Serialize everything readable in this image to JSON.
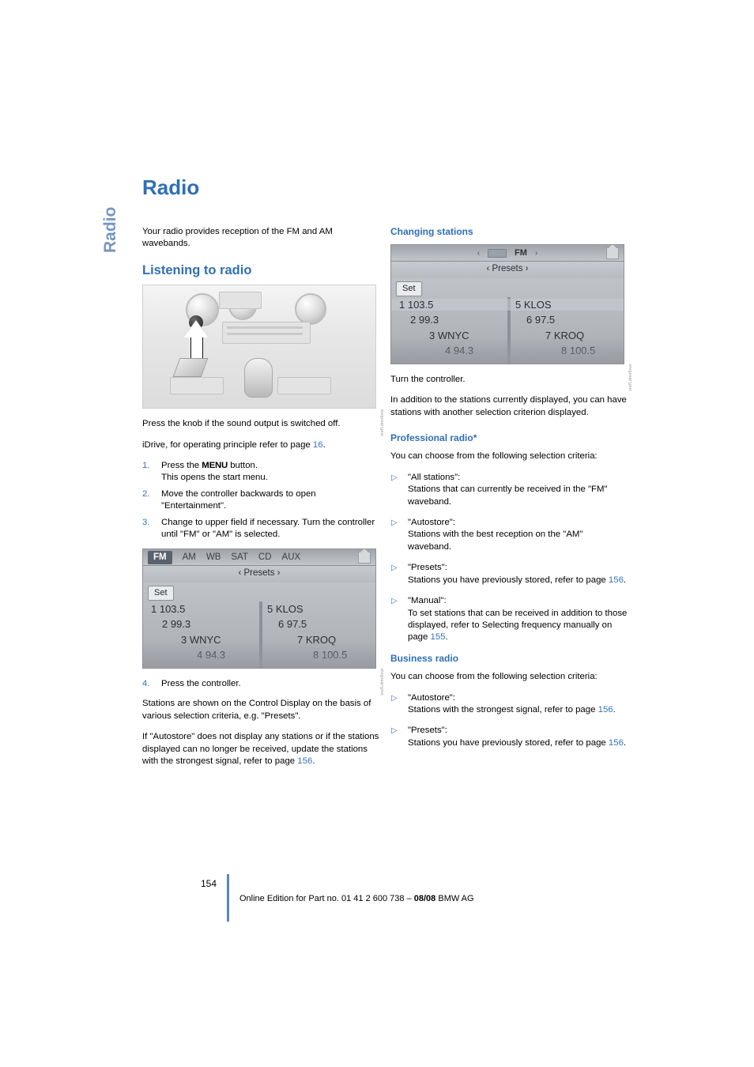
{
  "chapter_tab": "Radio",
  "page_title": "Radio",
  "left_column": {
    "intro": "Your radio provides reception of the FM and AM wavebands.",
    "section_heading": "Listening to radio",
    "figure_dashboard_credit": "vnd'Ldmn6vvv",
    "after_image_1": "Press the knob if the sound output is switched off.",
    "after_image_2_pre": "iDrive, for operating principle refer to page ",
    "after_image_2_ref": "16",
    "after_image_2_post": ".",
    "steps": [
      {
        "num": "1.",
        "text_pre": "Press the ",
        "bold": "MENU",
        "text_post": " button.",
        "line2": "This opens the start menu."
      },
      {
        "num": "2.",
        "text": "Move the controller backwards to open \"Entertainment\"."
      },
      {
        "num": "3.",
        "text": "Change to upper field if necessary. Turn the controller until \"FM\" or \"AM\" is selected."
      }
    ],
    "idrive_screen": {
      "tabs": [
        "FM",
        "AM",
        "WB",
        "SAT",
        "CD",
        "AUX"
      ],
      "active_tab": "FM",
      "presets_label": "‹ Presets ›",
      "set_button": "Set",
      "presets": [
        {
          "left": "1 103.5",
          "right": "5 KLOS"
        },
        {
          "left": "2 99.3",
          "right": "6 97.5"
        },
        {
          "left": "3 WNYC",
          "right": "7 KROQ"
        },
        {
          "left": "4 94.3",
          "right": "8 100.5"
        }
      ],
      "credit": "vnd'Ldmn6vvv"
    },
    "step4": {
      "num": "4.",
      "text": "Press the controller."
    },
    "para_after_step4": "Stations are shown on the Control Display on the basis of various selection criteria, e.g. \"Presets\".",
    "para_autostore_pre": "If \"Autostore\" does not display any stations or if the stations displayed can no longer be received, update the stations with the strongest signal, refer to page ",
    "para_autostore_ref": "156",
    "para_autostore_post": "."
  },
  "right_column": {
    "heading_changing": "Changing stations",
    "idrive_screen": {
      "title": "FM",
      "presets_label": "‹ Presets ›",
      "set_button": "Set",
      "presets": [
        {
          "left": "1 103.5",
          "right": "5 KLOS"
        },
        {
          "left": "2 99.3",
          "right": "6 97.5"
        },
        {
          "left": "3 WNYC",
          "right": "7 KROQ"
        },
        {
          "left": "4 94.3",
          "right": "8 100.5"
        }
      ],
      "credit": "vnd'Ldmn6vvv"
    },
    "turn_controller": "Turn the controller.",
    "addition_text": "In addition to the stations currently displayed, you can have stations with another selection criterion displayed.",
    "heading_professional": "Professional radio*",
    "professional_intro": "You can choose from the following selection criteria:",
    "professional_items": [
      {
        "title": "\"All stations\":",
        "body": "Stations that can currently be received in the \"FM\" waveband."
      },
      {
        "title": "\"Autostore\":",
        "body": "Stations with the best reception on the \"AM\" waveband."
      },
      {
        "title": "\"Presets\":",
        "body": "Stations you have previously stored, refer to page ",
        "ref": "156",
        "post": "."
      },
      {
        "title": "\"Manual\":",
        "body": "To set stations that can be received in addition to those displayed, refer to Selecting frequency manually on page ",
        "ref": "155",
        "post": "."
      }
    ],
    "heading_business": "Business radio",
    "business_intro": "You can choose from the following selection criteria:",
    "business_items": [
      {
        "title": "\"Autostore\":",
        "body": "Stations with the strongest signal, refer to page ",
        "ref": "156",
        "post": "."
      },
      {
        "title": "\"Presets\":",
        "body": "Stations you have previously stored, refer to page ",
        "ref": "156",
        "post": "."
      }
    ]
  },
  "footer": {
    "page_number": "154",
    "text_pre": "Online Edition for Part no. 01 41 2 600 738 – ",
    "text_bold": "08/08",
    "text_post": " BMW AG"
  },
  "colors": {
    "accent_blue": "#2f6fb5",
    "tab_blue": "#7596c4",
    "link_blue": "#3573b9"
  }
}
